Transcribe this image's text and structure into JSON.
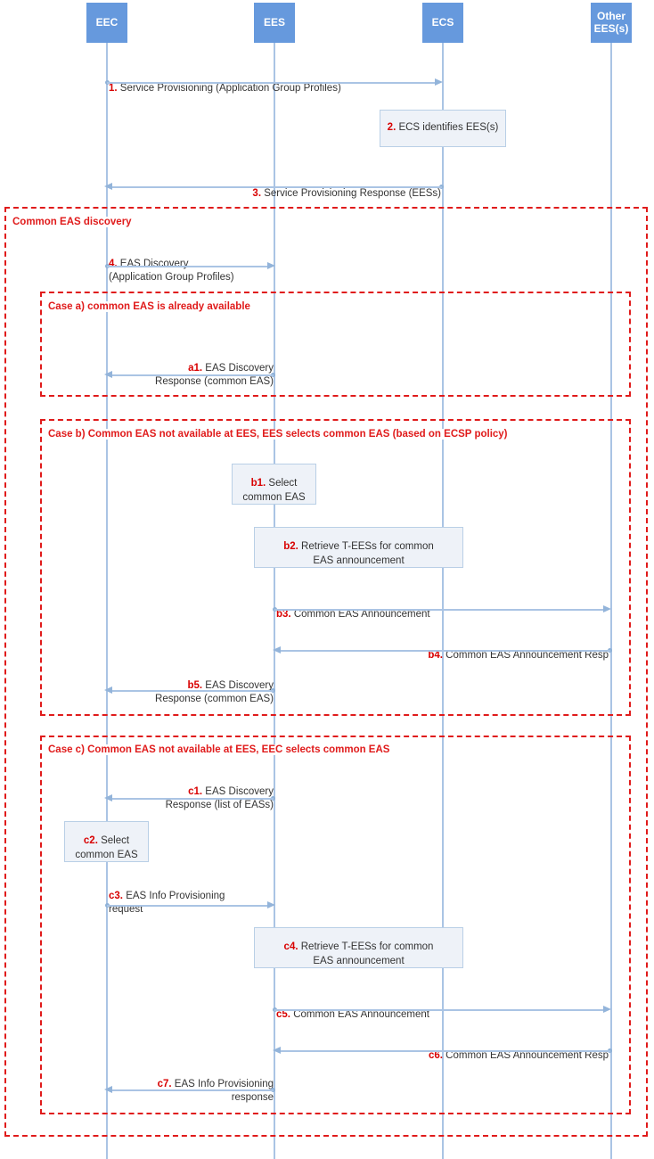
{
  "diagram": {
    "title": "Common EAS discovery sequence",
    "colors": {
      "actor_fill": "#6699dd",
      "lifeline": "#aac4e4",
      "fragment_border": "#e01b1b",
      "fragment_label": "#e01b1b",
      "process_fill": "#eef2f8",
      "process_border": "#b9cfe6",
      "arrow": "#aac4e4",
      "step_number": "#d80000",
      "text": "#333333"
    }
  },
  "actors": [
    {
      "name": "eec",
      "label": "EEC"
    },
    {
      "name": "ees",
      "label": "EES"
    },
    {
      "name": "ecs",
      "label": "ECS"
    },
    {
      "name": "other-ees",
      "label": "Other\nEES(s)"
    }
  ],
  "fragments": [
    {
      "name": "common-eas-discovery",
      "label": "Common EAS discovery"
    },
    {
      "name": "case-a",
      "label": "Case a) common EAS is already available"
    },
    {
      "name": "case-b",
      "label": "Case b) Common EAS not available at EES, EES selects common EAS (based on ECSP policy)"
    },
    {
      "name": "case-c",
      "label": "Case c) Common EAS not available at EES, EEC selects common EAS"
    }
  ],
  "messages": {
    "m1": {
      "num": "1.",
      "text": " Service Provisioning (Application Group Profiles)",
      "from": "EEC",
      "to": "ECS",
      "dir": "right"
    },
    "m3": {
      "num": "3.",
      "text": " Service Provisioning Response (EESs)",
      "from": "ECS",
      "to": "EEC",
      "dir": "left"
    },
    "m4": {
      "num": "4.",
      "text": " EAS Discovery\n(Application Group Profiles)",
      "from": "EEC",
      "to": "EES",
      "dir": "right"
    },
    "a1": {
      "num": "a1.",
      "text": " EAS Discovery\nResponse (common EAS)",
      "from": "EES",
      "to": "EEC",
      "dir": "left"
    },
    "b3": {
      "num": "b3.",
      "text": " Common EAS Announcement",
      "from": "EES",
      "to": "Other EES(s)",
      "dir": "right"
    },
    "b4": {
      "num": "b4.",
      "text": " Common EAS Announcement Resp",
      "from": "Other EES(s)",
      "to": "EES",
      "dir": "left"
    },
    "b5": {
      "num": "b5.",
      "text": " EAS Discovery\nResponse (common EAS)",
      "from": "EES",
      "to": "EEC",
      "dir": "left"
    },
    "c1": {
      "num": "c1.",
      "text": " EAS Discovery\nResponse (list of EASs)",
      "from": "EES",
      "to": "EEC",
      "dir": "left"
    },
    "c3": {
      "num": "c3.",
      "text": " EAS Info Provisioning\nrequest",
      "from": "EEC",
      "to": "EES",
      "dir": "right"
    },
    "c5": {
      "num": "c5.",
      "text": " Common EAS Announcement",
      "from": "EES",
      "to": "Other EES(s)",
      "dir": "right"
    },
    "c6": {
      "num": "c6.",
      "text": " Common EAS Announcement Resp",
      "from": "Other EES(s)",
      "to": "EES",
      "dir": "left"
    },
    "c7": {
      "num": "c7.",
      "text": " EAS Info Provisioning\nresponse",
      "from": "EES",
      "to": "EEC",
      "dir": "left"
    }
  },
  "processes": {
    "p2": {
      "num": "2.",
      "text": " ECS identifies EES(s)",
      "actor": "ECS"
    },
    "b1": {
      "num": "b1.",
      "text": " Select\ncommon EAS",
      "actor": "EES"
    },
    "b2": {
      "num": "b2.",
      "text": " Retrieve T-EESs for common\nEAS announcement",
      "actor": "EES-ECS"
    },
    "c2": {
      "num": "c2.",
      "text": " Select\ncommon EAS",
      "actor": "EEC"
    },
    "c4": {
      "num": "c4.",
      "text": " Retrieve T-EESs for common\nEAS announcement",
      "actor": "EES-ECS"
    }
  }
}
